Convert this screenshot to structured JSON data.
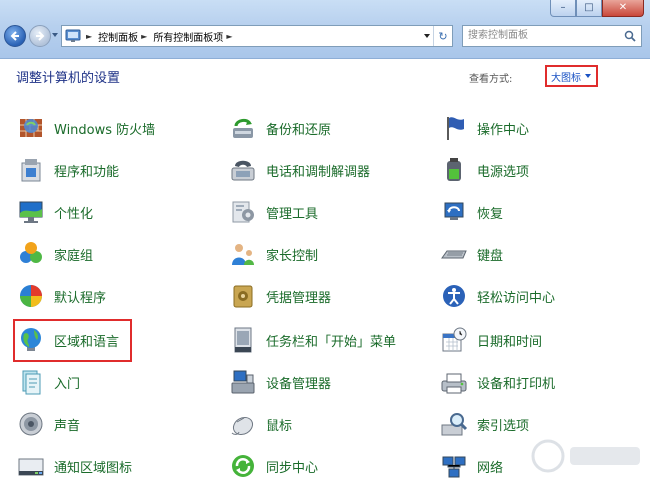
{
  "address": {
    "crumbs": [
      "控制面板",
      "所有控制面板项"
    ]
  },
  "search": {
    "placeholder": "搜索控制面板"
  },
  "header": {
    "title": "调整计算机的设置",
    "view_by_label": "查看方式:",
    "view_by_value": "大图标"
  },
  "items": [
    {
      "label": "Windows 防火墙",
      "icon": "firewall-icon"
    },
    {
      "label": "备份和还原",
      "icon": "backup-restore-icon"
    },
    {
      "label": "操作中心",
      "icon": "action-center-flag-icon"
    },
    {
      "label": "程序和功能",
      "icon": "programs-features-icon"
    },
    {
      "label": "电话和调制解调器",
      "icon": "phone-modem-icon"
    },
    {
      "label": "电源选项",
      "icon": "power-options-icon"
    },
    {
      "label": "个性化",
      "icon": "personalization-icon"
    },
    {
      "label": "管理工具",
      "icon": "admin-tools-icon"
    },
    {
      "label": "恢复",
      "icon": "recovery-icon"
    },
    {
      "label": "家庭组",
      "icon": "homegroup-icon"
    },
    {
      "label": "家长控制",
      "icon": "parental-controls-icon"
    },
    {
      "label": "键盘",
      "icon": "keyboard-icon"
    },
    {
      "label": "默认程序",
      "icon": "default-programs-icon"
    },
    {
      "label": "凭据管理器",
      "icon": "credential-manager-icon"
    },
    {
      "label": "轻松访问中心",
      "icon": "ease-of-access-icon"
    },
    {
      "label": "区域和语言",
      "icon": "region-language-globe-icon"
    },
    {
      "label": "任务栏和「开始」菜单",
      "icon": "taskbar-start-menu-icon"
    },
    {
      "label": "日期和时间",
      "icon": "date-time-icon"
    },
    {
      "label": "入门",
      "icon": "getting-started-icon"
    },
    {
      "label": "设备管理器",
      "icon": "device-manager-icon"
    },
    {
      "label": "设备和打印机",
      "icon": "devices-printers-icon"
    },
    {
      "label": "声音",
      "icon": "sound-icon"
    },
    {
      "label": "鼠标",
      "icon": "mouse-icon"
    },
    {
      "label": "索引选项",
      "icon": "indexing-options-icon"
    },
    {
      "label": "通知区域图标",
      "icon": "notification-area-icon"
    },
    {
      "label": "同步中心",
      "icon": "sync-center-icon"
    },
    {
      "label": "网络",
      "icon": "network-icon"
    }
  ],
  "colors": {
    "link_green": "#1a6b2a",
    "title_blue": "#1e3287",
    "highlight_red": "#e02c2c"
  }
}
